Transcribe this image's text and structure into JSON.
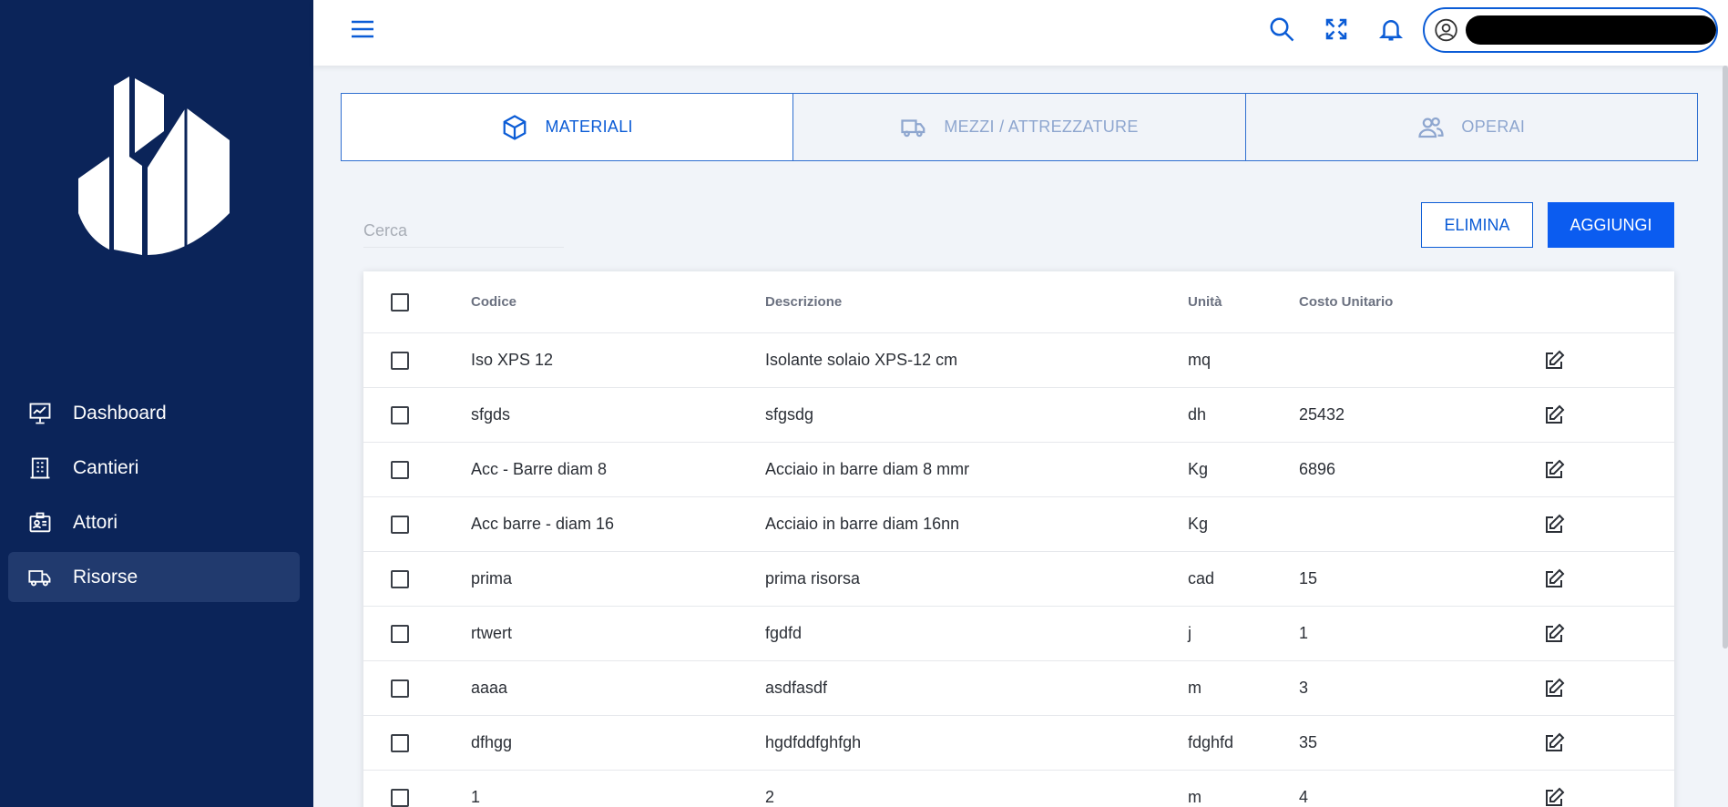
{
  "sidebar": {
    "items": [
      {
        "label": "Dashboard",
        "icon": "presentation-chart-icon"
      },
      {
        "label": "Cantieri",
        "icon": "building-icon"
      },
      {
        "label": "Attori",
        "icon": "id-card-icon"
      },
      {
        "label": "Risorse",
        "icon": "truck-icon",
        "active": true
      }
    ]
  },
  "header": {
    "icons": [
      "menu-icon",
      "search-icon",
      "fullscreen-icon",
      "bell-icon",
      "user-circle-icon"
    ],
    "user_name": ""
  },
  "tabs": [
    {
      "label": "MATERIALI",
      "icon": "cube-icon",
      "active": true
    },
    {
      "label": "MEZZI / ATTREZZATURE",
      "icon": "truck-icon",
      "active": false
    },
    {
      "label": "OPERAI",
      "icon": "users-icon",
      "active": false
    }
  ],
  "toolbar": {
    "search_placeholder": "Cerca",
    "delete_label": "ELIMINA",
    "add_label": "AGGIUNGI"
  },
  "table": {
    "columns": [
      "Codice",
      "Descrizione",
      "Unità",
      "Costo Unitario"
    ],
    "rows": [
      {
        "code": "Iso XPS 12",
        "desc": "Isolante solaio XPS-12 cm",
        "unit": "mq",
        "cost": ""
      },
      {
        "code": "sfgds",
        "desc": "sfgsdg",
        "unit": "dh",
        "cost": "25432"
      },
      {
        "code": "Acc - Barre diam 8",
        "desc": "Acciaio in barre diam 8 mmr",
        "unit": "Kg",
        "cost": "6896"
      },
      {
        "code": "Acc barre - diam 16",
        "desc": "Acciaio in barre diam 16nn",
        "unit": "Kg",
        "cost": ""
      },
      {
        "code": "prima",
        "desc": "prima risorsa",
        "unit": "cad",
        "cost": "15"
      },
      {
        "code": "rtwert",
        "desc": "fgdfd",
        "unit": "j",
        "cost": "1"
      },
      {
        "code": "aaaa",
        "desc": "asdfasdf",
        "unit": "m",
        "cost": "3"
      },
      {
        "code": "dfhgg",
        "desc": "hgdfddfghfgh",
        "unit": "fdghfd",
        "cost": "35"
      },
      {
        "code": "1",
        "desc": "2",
        "unit": "m",
        "cost": "4"
      }
    ]
  },
  "colors": {
    "sidebar_bg": "#0b2459",
    "sidebar_active": "#213a6e",
    "accent": "#0b5cd6",
    "primary_button": "#0b5cf0",
    "page_bg": "#f1f4f9"
  }
}
